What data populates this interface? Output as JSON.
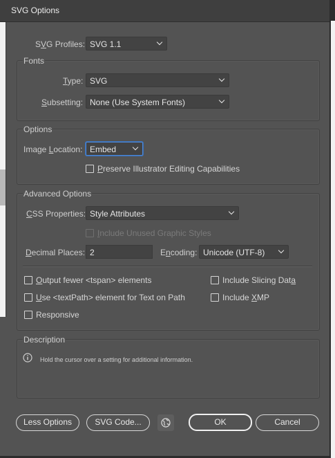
{
  "window": {
    "title": "SVG Options"
  },
  "profile": {
    "label_pre": "S",
    "label_u": "V",
    "label_post": "G Profiles:",
    "value": "SVG 1.1"
  },
  "fonts": {
    "group_label": "Fonts",
    "type_label_pre": "",
    "type_label_u": "T",
    "type_label_post": "ype:",
    "type_value": "SVG",
    "subsetting_label_pre": "",
    "subsetting_label_u": "S",
    "subsetting_label_post": "ubsetting:",
    "subsetting_value": "None (Use System Fonts)"
  },
  "options": {
    "group_label": "Options",
    "image_location_label_pre": "Image ",
    "image_location_label_u": "L",
    "image_location_label_post": "ocation:",
    "image_location_value": "Embed",
    "preserve_pre": "",
    "preserve_u": "P",
    "preserve_post": "reserve Illustrator Editing Capabilities",
    "preserve_checked": false
  },
  "advanced": {
    "group_label": "Advanced Options",
    "css_label_pre": "",
    "css_label_u": "C",
    "css_label_post": "SS Properties:",
    "css_value": "Style Attributes",
    "unused_pre": "",
    "unused_u": "I",
    "unused_post": "nclude Unused Graphic Styles",
    "decimal_label_pre": "",
    "decimal_label_u": "D",
    "decimal_label_post": "ecimal Places:",
    "decimal_value": "2",
    "encoding_label_pre": "E",
    "encoding_label_u": "n",
    "encoding_label_post": "coding:",
    "encoding_value": "Unicode (UTF-8)",
    "tspan_pre": "",
    "tspan_u": "O",
    "tspan_post": "utput fewer <tspan> elements",
    "textpath_pre": "",
    "textpath_u": "U",
    "textpath_post": "se <textPath> element for Text on Path",
    "responsive_pre": "Responsive",
    "responsive_u": "",
    "responsive_post": "",
    "slicing_pre": "Include Slicing Dat",
    "slicing_u": "a",
    "slicing_post": "",
    "xmp_pre": "Include ",
    "xmp_u": "X",
    "xmp_post": "MP"
  },
  "description": {
    "group_label": "Description",
    "text": "Hold the cursor over a setting for additional information."
  },
  "buttons": {
    "less_options": "Less Options",
    "svg_code": "SVG Code...",
    "ok": "OK",
    "cancel": "Cancel"
  },
  "icons": {
    "info": "info-icon",
    "globe": "globe-icon",
    "chevron": "chevron-down-icon"
  },
  "colors": {
    "dialog_bg": "#535353",
    "title_bar": "#3f3f3f",
    "focus_ring": "#4c88d6"
  }
}
